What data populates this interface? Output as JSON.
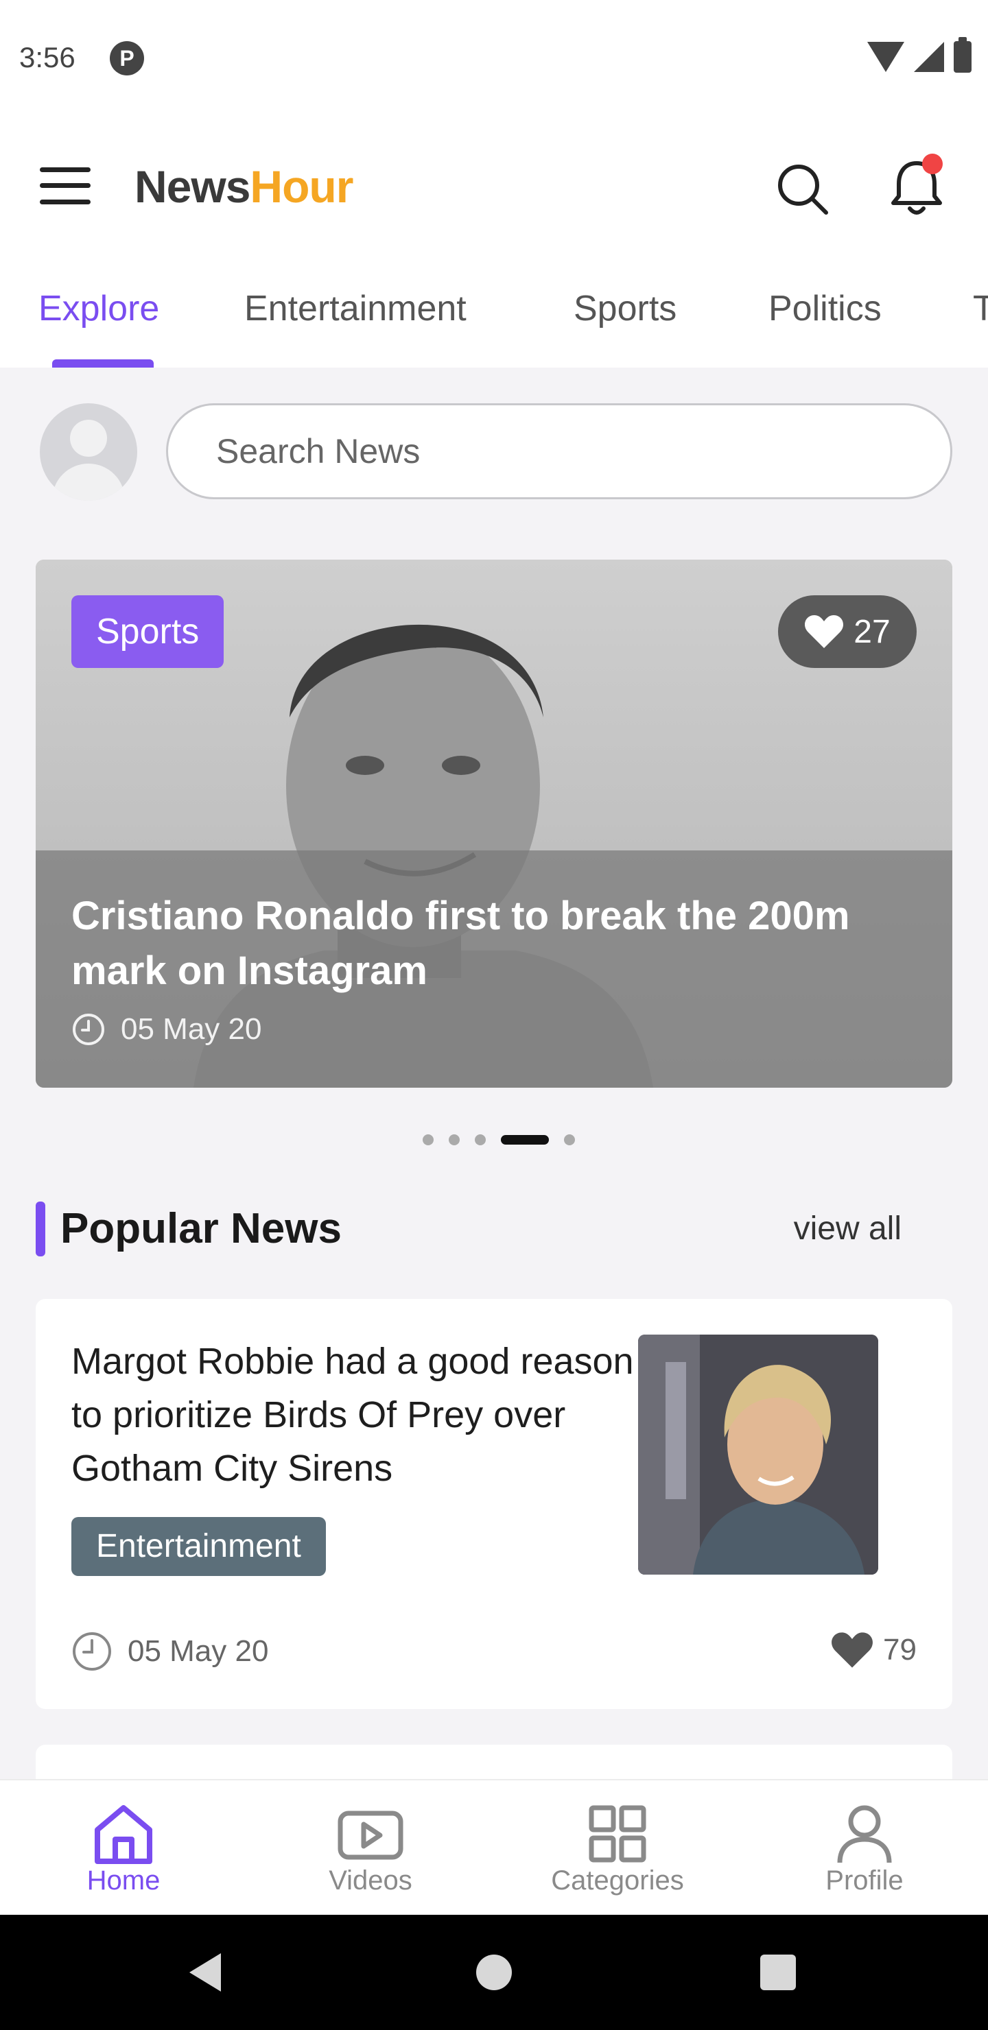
{
  "status_bar": {
    "time": "3:56",
    "app_icon": "pocket-casts-icon"
  },
  "app_bar": {
    "brand_part1": "News",
    "brand_part2": "Hour",
    "colors": {
      "brand_dark": "#3a3a3a",
      "brand_accent": "#f5a623",
      "notification_dot": "#f04444"
    }
  },
  "tabs": [
    {
      "label": "Explore",
      "active": true
    },
    {
      "label": "Entertainment",
      "active": false
    },
    {
      "label": "Sports",
      "active": false
    },
    {
      "label": "Politics",
      "active": false
    },
    {
      "label": "T",
      "active": false
    }
  ],
  "accent_color": "#7a4df0",
  "search": {
    "placeholder": "Search News"
  },
  "hero": {
    "category": "Sports",
    "likes": "27",
    "title": "Cristiano Ronaldo first to break the 200m mark on Instagram",
    "date": "05 May 20"
  },
  "carousel": {
    "slide_count": 5,
    "active_index": 3
  },
  "popular": {
    "title": "Popular News",
    "view_all": "view all",
    "items": [
      {
        "title": "Margot Robbie had a good reason to prioritize Birds Of Prey over Gotham City Sirens",
        "category": "Entertainment",
        "date": "05 May 20",
        "likes": "79"
      }
    ]
  },
  "bottom_nav": [
    {
      "label": "Home",
      "icon": "home-icon",
      "active": true
    },
    {
      "label": "Videos",
      "icon": "video-play-icon",
      "active": false
    },
    {
      "label": "Categories",
      "icon": "grid-icon",
      "active": false
    },
    {
      "label": "Profile",
      "icon": "user-icon",
      "active": false
    }
  ]
}
